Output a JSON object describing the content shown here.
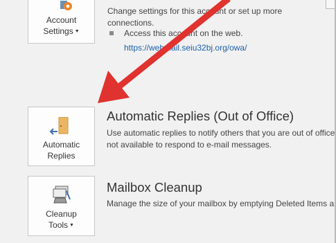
{
  "account_settings": {
    "label_line1": "Account",
    "label_line2": "Settings",
    "description_line1": "Change settings for this account or set up more",
    "description_line2": "connections.",
    "bullet_text": "Access this account on the web.",
    "web_link": "https://webmail.seiu32bj.org/owa/"
  },
  "automatic_replies": {
    "button_line1": "Automatic",
    "button_line2": "Replies",
    "heading": "Automatic Replies (Out of Office)",
    "description_line1": "Use automatic replies to notify others that you are out of office",
    "description_line2": "not available to respond to e-mail messages."
  },
  "mailbox_cleanup": {
    "button_line1": "Cleanup",
    "button_line2": "Tools",
    "heading": "Mailbox Cleanup",
    "description_line1": "Manage the size of your mailbox by emptying Deleted Items and"
  },
  "colors": {
    "arrow": "#e0322f",
    "link": "#1c5fa8",
    "background": "#f1f1f1"
  }
}
